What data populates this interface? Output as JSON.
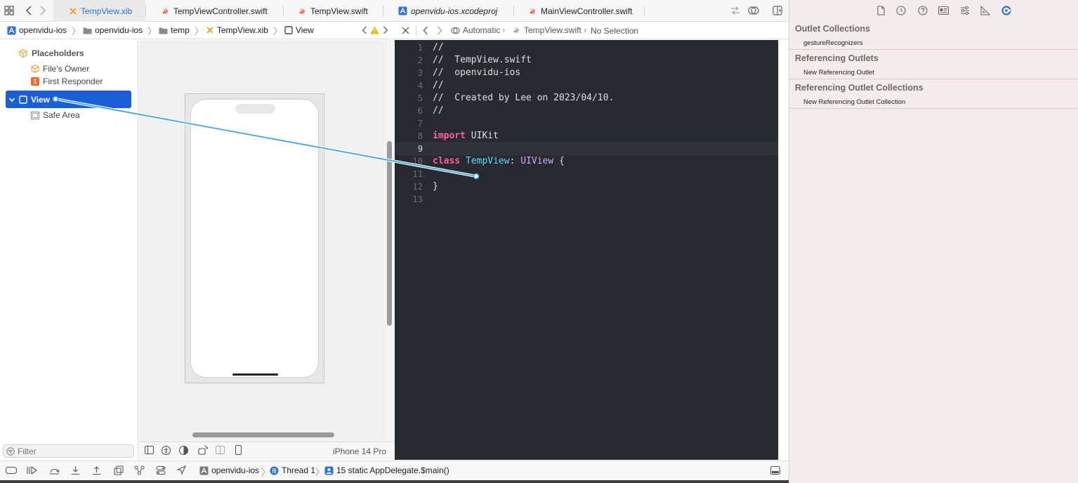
{
  "tabs": [
    {
      "label": "TempView.xib",
      "icon": "xib-icon",
      "active": true
    },
    {
      "label": "TempViewController.swift",
      "icon": "swift-icon",
      "active": false
    },
    {
      "label": "TempView.swift",
      "icon": "swift-icon",
      "active": false
    },
    {
      "label": "openvidu-ios.xcodeproj",
      "icon": "xcodeproj-icon",
      "active": false
    },
    {
      "label": "MainViewController.swift",
      "icon": "swift-icon",
      "active": false
    }
  ],
  "left_jumpbar": {
    "crumbs": [
      "openvidu-ios",
      "openvidu-ios",
      "temp",
      "TempView.xib",
      "View"
    ]
  },
  "right_jumpbar": {
    "mode": "Automatic",
    "file": "TempView.swift",
    "selection": "No Selection"
  },
  "outline": {
    "placeholders": "Placeholders",
    "files_owner": "File's Owner",
    "first_responder_badge": "1",
    "first_responder": "First Responder",
    "view": "View",
    "safe_area": "Safe Area"
  },
  "canvas": {
    "device": "iPhone 14 Pro"
  },
  "filter": {
    "placeholder": "Filter"
  },
  "code": {
    "lines": [
      {
        "n": "1",
        "text": "//"
      },
      {
        "n": "2",
        "text": "//  TempView.swift"
      },
      {
        "n": "3",
        "text": "//  openvidu-ios"
      },
      {
        "n": "4",
        "text": "//"
      },
      {
        "n": "5",
        "text": "//  Created by Lee on 2023/04/10."
      },
      {
        "n": "6",
        "text": "//"
      },
      {
        "n": "7",
        "text": ""
      },
      {
        "n": "8",
        "kw": "import",
        "rest": " UIKit"
      },
      {
        "n": "9",
        "text": ""
      },
      {
        "n": "10",
        "kw": "class",
        "name": "TempView",
        "colon": ": ",
        "super": "UIView",
        "tail": " {"
      },
      {
        "n": "11",
        "text": ""
      },
      {
        "n": "12",
        "text": "}"
      },
      {
        "n": "13",
        "text": ""
      }
    ]
  },
  "inspector": {
    "sections": [
      {
        "title": "Outlet Collections",
        "items": [
          "gestureRecognizers"
        ]
      },
      {
        "title": "Referencing Outlets",
        "items": [
          "New Referencing Outlet"
        ]
      },
      {
        "title": "Referencing Outlet Collections",
        "items": [
          "New Referencing Outlet Collection"
        ]
      }
    ]
  },
  "debugbar": {
    "target": "openvidu-ios",
    "thread": "Thread 1",
    "frame": "15 static AppDelegate.$main()"
  },
  "colors": {
    "accent": "#2f6fe0",
    "selection": "#1a5fd6",
    "connection_line": "#3aa7e8",
    "editor_bg": "#292a30",
    "comment": "#6bbf59",
    "keyword": "#fc5fa3",
    "type": "#5dd8ff",
    "super_type": "#d0a8ff",
    "inspector_bg": "#f4ecec"
  }
}
